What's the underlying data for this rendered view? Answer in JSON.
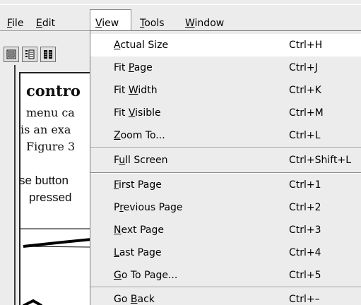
{
  "menubar": {
    "menus": [
      {
        "pre": "",
        "mn": "F",
        "post": "ile"
      },
      {
        "pre": "",
        "mn": "E",
        "post": "dit"
      },
      {
        "pre": "",
        "mn": "V",
        "post": "iew"
      },
      {
        "pre": "",
        "mn": "T",
        "post": "ools"
      },
      {
        "pre": "",
        "mn": "W",
        "post": "indow"
      }
    ]
  },
  "toolbar": {
    "buttons": [
      {
        "icon": "single-page-view-icon"
      },
      {
        "icon": "continuous-page-view-icon"
      },
      {
        "icon": "two-page-view-icon"
      }
    ]
  },
  "document": {
    "lines": [
      "contro",
      "menu ca",
      "is an exa",
      "Figure 3",
      "se button",
      "pressed"
    ]
  },
  "view_menu": {
    "items": [
      {
        "pre": "",
        "mn": "A",
        "post": "ctual Size",
        "shortcut": "Ctrl+H"
      },
      {
        "pre": "Fit ",
        "mn": "P",
        "post": "age",
        "shortcut": "Ctrl+J"
      },
      {
        "pre": "Fit ",
        "mn": "W",
        "post": "idth",
        "shortcut": "Ctrl+K"
      },
      {
        "pre": "Fit ",
        "mn": "V",
        "post": "isible",
        "shortcut": "Ctrl+M"
      },
      {
        "pre": "",
        "mn": "Z",
        "post": "oom To...",
        "shortcut": "Ctrl+L"
      },
      {
        "pre": "F",
        "mn": "u",
        "post": "ll Screen",
        "shortcut": "Ctrl+Shift+L"
      },
      {
        "pre": "",
        "mn": "F",
        "post": "irst Page",
        "shortcut": "Ctrl+1"
      },
      {
        "pre": "P",
        "mn": "r",
        "post": "evious Page",
        "shortcut": "Ctrl+2"
      },
      {
        "pre": "",
        "mn": "N",
        "post": "ext Page",
        "shortcut": "Ctrl+3"
      },
      {
        "pre": "",
        "mn": "L",
        "post": "ast Page",
        "shortcut": "Ctrl+4"
      },
      {
        "pre": "",
        "mn": "G",
        "post": "o To Page...",
        "shortcut": "Ctrl+5"
      },
      {
        "pre": "Go ",
        "mn": "B",
        "post": "ack",
        "shortcut": "Ctrl+–"
      }
    ]
  },
  "colors": {
    "menu_background": "#ececec",
    "highlight_background": "#ffffff",
    "text": "#000000"
  }
}
